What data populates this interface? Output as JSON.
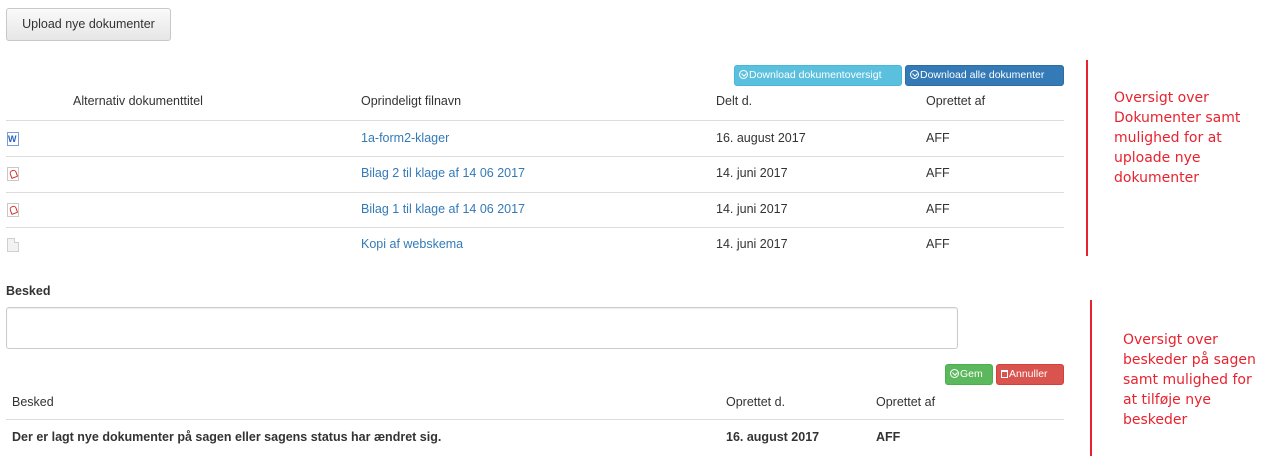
{
  "upload_button": "Upload nye dokumenter",
  "doc_buttons": {
    "download_overview": "Download dokumentoversigt",
    "download_all": "Download alle dokumenter"
  },
  "documents": {
    "headers": [
      "Alternativ dokumenttitel",
      "Oprindeligt filnavn",
      "Delt d.",
      "Oprettet af"
    ],
    "rows": [
      {
        "icon": "word-file-icon",
        "filename": "1a-form2-klager",
        "shared": "16. august 2017",
        "created_by": "AFF"
      },
      {
        "icon": "pdf-file-icon",
        "filename": "Bilag 2 til klage af 14 06 2017",
        "shared": "14. juni 2017",
        "created_by": "AFF"
      },
      {
        "icon": "pdf-file-icon",
        "filename": "Bilag 1 til klage af 14 06 2017",
        "shared": "14. juni 2017",
        "created_by": "AFF"
      },
      {
        "icon": "blank-file-icon",
        "filename": "Kopi af webskema",
        "shared": "14. juni 2017",
        "created_by": "AFF"
      }
    ]
  },
  "message": {
    "label": "Besked",
    "value": "",
    "save": "Gem",
    "cancel": "Annuller",
    "headers": [
      "Besked",
      "Oprettet d.",
      "Oprettet af"
    ],
    "rows": [
      {
        "text": "Der er lagt nye dokumenter på sagen eller sagens status har ændret sig.",
        "date": "16. august 2017",
        "by": "AFF"
      }
    ]
  },
  "annotations": {
    "documents": [
      "Oversigt over",
      "Dokumenter samt",
      "mulighed for at",
      "uploade nye",
      "dokumenter"
    ],
    "messages": [
      "Oversigt over",
      "beskeder på sagen",
      "samt mulighed for",
      "at tilføje nye",
      "beskeder"
    ]
  },
  "colors": {
    "link": "#337ab7",
    "info": "#5bc0de",
    "primary": "#337ab7",
    "success": "#5cb85c",
    "danger": "#d9534f",
    "annotation": "#e8232f"
  }
}
